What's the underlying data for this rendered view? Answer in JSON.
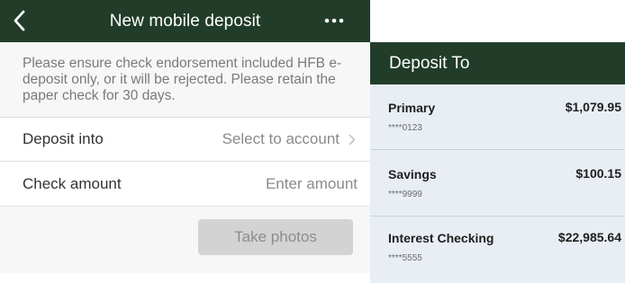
{
  "deposit_form": {
    "title": "New mobile deposit",
    "back_icon": "chevron-left-icon",
    "more_icon": "ellipsis-icon",
    "notice": "Please ensure check endorsement included HFB e-deposit only, or it will be rejected. Please retain the paper check for 30 days.",
    "rows": [
      {
        "label": "Deposit into",
        "value": "Select to account",
        "icon": "chevron-right-icon"
      },
      {
        "label": "Check amount",
        "value": "Enter amount"
      }
    ],
    "take_photos_label": "Take photos"
  },
  "deposit_to": {
    "title": "Deposit To",
    "accounts": [
      {
        "name": "Primary",
        "number": "****0123",
        "balance": "$1,079.95"
      },
      {
        "name": "Savings",
        "number": "****9999",
        "balance": "$100.15"
      },
      {
        "name": "Interest Checking",
        "number": "****5555",
        "balance": "$22,985.64"
      }
    ]
  },
  "colors": {
    "header_bg": "#213d2a",
    "panel_bg": "#e8eef4",
    "button_bg": "#d3d3d3"
  }
}
